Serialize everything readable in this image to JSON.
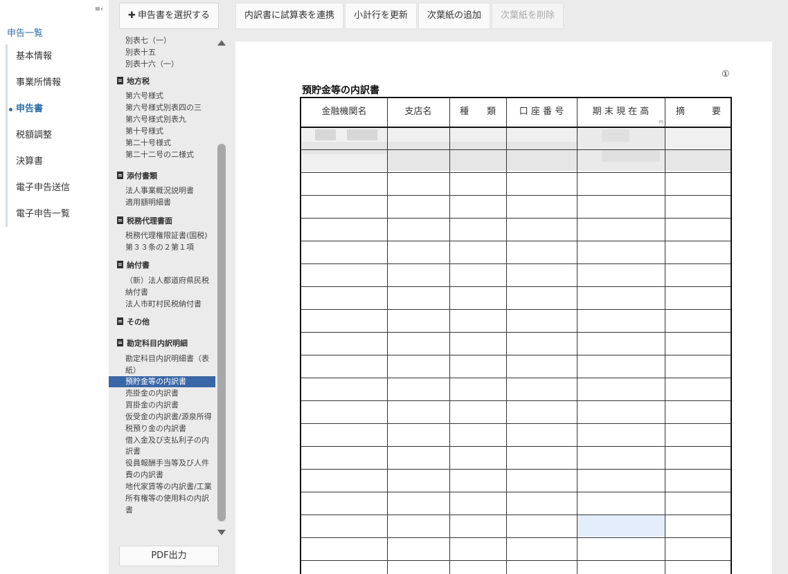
{
  "nav": {
    "title": "申告一覧",
    "items": [
      {
        "label": "基本情報",
        "active": false
      },
      {
        "label": "事業所情報",
        "active": false
      },
      {
        "label": "申告書",
        "active": true
      },
      {
        "label": "税額調整",
        "active": false
      },
      {
        "label": "決算書",
        "active": false
      },
      {
        "label": "電子申告送信",
        "active": false
      },
      {
        "label": "電子申告一覧",
        "active": false
      }
    ]
  },
  "forms": {
    "select_button": "申告書を選択する",
    "pdf_button": "PDF出力",
    "top_items": [
      "別表七（一）",
      "別表十五",
      "別表十六（一）"
    ],
    "groups": [
      {
        "label": "地方税",
        "items": [
          "第六号様式",
          "第六号様式別表四の三",
          "第六号様式別表九",
          "第十号様式",
          "第二十号様式",
          "第二十二号の二様式"
        ]
      },
      {
        "label": "添付書類",
        "items": [
          "法人事業概況説明書",
          "適用額明細書"
        ]
      },
      {
        "label": "税務代理書面",
        "items": [
          "税務代理権限証書(国税)",
          "第３３条の２第１項"
        ]
      },
      {
        "label": "納付書",
        "items": [
          "（新）法人都道府県民税",
          "納付書",
          "法人市町村民税納付書"
        ]
      },
      {
        "label": "その他",
        "items": []
      },
      {
        "label": "勘定科目内訳明細",
        "items": [
          "勘定科目内訳明細書（表",
          "紙）",
          "預貯金等の内訳書",
          "売掛金の内訳書",
          "買掛金の内訳書",
          "仮受金の内訳書/源泉所得",
          "税預り金の内訳書",
          "借入金及び支払利子の内",
          "訳書",
          "役員報酬手当等及び人件",
          "費の内訳書",
          "地代家賃等の内訳書/工業",
          "所有権等の使用料の内訳",
          "書"
        ]
      }
    ],
    "selected_item": "預貯金等の内訳書"
  },
  "toolbar": {
    "buttons": [
      "内訳書に試算表を連携",
      "小計行を更新",
      "次葉紙の追加",
      "次葉紙を削除"
    ]
  },
  "sheet": {
    "page_number": "①",
    "title": "預貯金等の内訳書",
    "columns": [
      "金融機関名",
      "支店名",
      "種　　類",
      "口 座 番 号",
      "期 末 現 在 高",
      "摘　　　要"
    ],
    "unit": "円"
  }
}
